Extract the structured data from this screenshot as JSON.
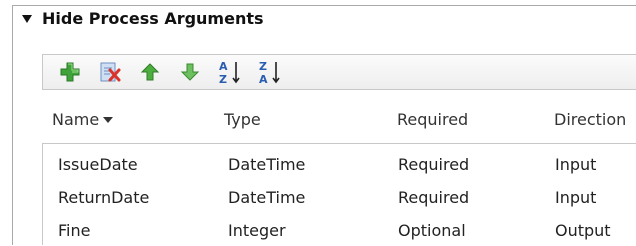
{
  "section": {
    "title": "Hide Process Arguments"
  },
  "toolbar": {
    "buttons": [
      {
        "icon": "add-icon"
      },
      {
        "icon": "delete-icon"
      },
      {
        "icon": "move-up-icon"
      },
      {
        "icon": "move-down-icon"
      },
      {
        "icon": "sort-ascending-icon",
        "top": "A",
        "bottom": "Z"
      },
      {
        "icon": "sort-descending-icon",
        "top": "Z",
        "bottom": "A"
      }
    ]
  },
  "table": {
    "columns": [
      "Name",
      "Type",
      "Required",
      "Direction"
    ],
    "rows": [
      {
        "name": "IssueDate",
        "type": "DateTime",
        "required": "Required",
        "direction": "Input"
      },
      {
        "name": "ReturnDate",
        "type": "DateTime",
        "required": "Required",
        "direction": "Input"
      },
      {
        "name": "Fine",
        "type": "Integer",
        "required": "Optional",
        "direction": "Output"
      }
    ]
  },
  "colors": {
    "add_green": "#3fa33a",
    "up_green": "#4cae3f",
    "delete_red": "#d9342b",
    "sort_blue": "#2a5db0"
  }
}
